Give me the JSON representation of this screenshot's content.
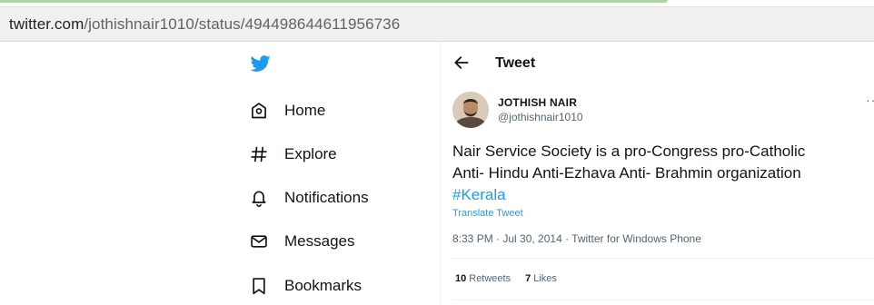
{
  "browser": {
    "url_domain": "twitter.com",
    "url_path": "/jothishnair1010/status/494498644611956736"
  },
  "sidebar": {
    "logo_icon": "twitter-bird-icon",
    "items": [
      {
        "label": "Home",
        "icon": "home-icon"
      },
      {
        "label": "Explore",
        "icon": "hashtag-icon"
      },
      {
        "label": "Notifications",
        "icon": "bell-icon"
      },
      {
        "label": "Messages",
        "icon": "envelope-icon"
      },
      {
        "label": "Bookmarks",
        "icon": "bookmark-icon"
      }
    ]
  },
  "header": {
    "title": "Tweet",
    "back_icon": "arrow-left-icon"
  },
  "tweet": {
    "author_name": "JOTHISH NAIR",
    "author_handle": "@jothishnair1010",
    "more_label": "···",
    "text_line1": "Nair Service Society is a pro-Congress pro-Catholic",
    "text_line2": "Anti- Hindu Anti-Ezhava Anti- Brahmin organization",
    "hashtag": "#Kerala",
    "translate_label": "Translate Tweet",
    "timestamp": "8:33 PM · Jul 30, 2014 · Twitter for Windows Phone",
    "retweets_count": "10",
    "retweets_label": "Retweets",
    "likes_count": "7",
    "likes_label": "Likes"
  },
  "colors": {
    "accent": "#1d9bf0",
    "text": "#0f1419",
    "muted": "#536471"
  }
}
